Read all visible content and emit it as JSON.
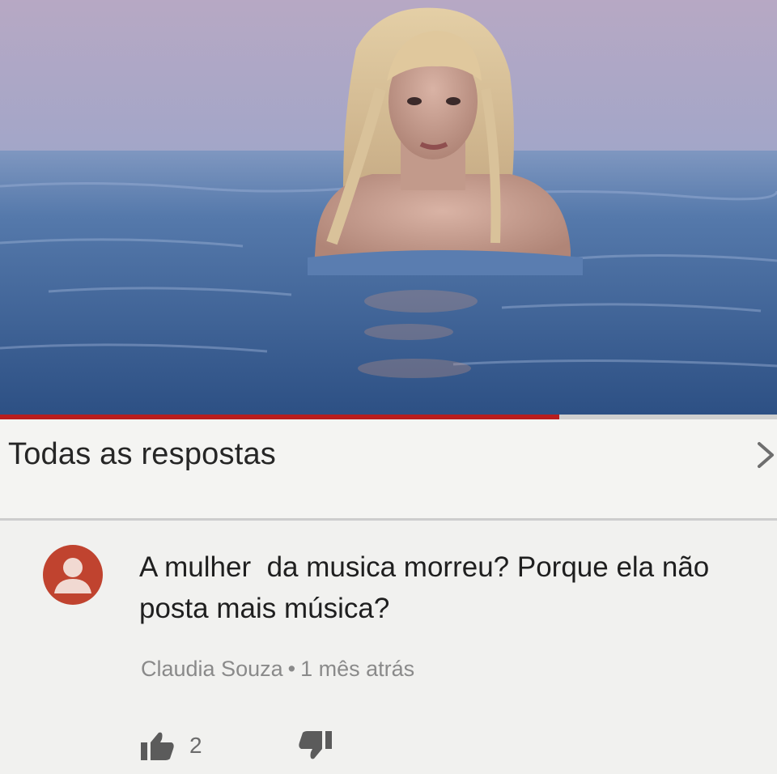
{
  "video": {
    "thumbnail_icon": "woman-in-sea-photo",
    "progress_fraction": 0.72,
    "progress_color": "#b81d1d"
  },
  "replies": {
    "title": "Todas as respostas",
    "chevron_icon": "chevron-right-icon"
  },
  "comment": {
    "avatar_icon": "default-avatar-icon",
    "avatar_color": "#c0432f",
    "text": "A mulher  da musica morreu? Porque ela não  posta mais música?",
    "author": "Claudia Souza",
    "separator": "•",
    "time": "1 mês atrás",
    "likes": "2",
    "like_icon": "thumbs-up-icon",
    "dislike_icon": "thumbs-down-icon"
  }
}
